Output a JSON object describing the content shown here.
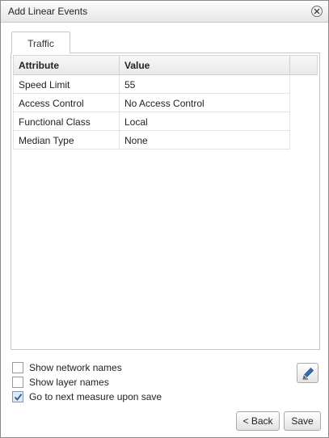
{
  "window": {
    "title": "Add Linear Events"
  },
  "tabs": [
    {
      "label": "Traffic"
    }
  ],
  "table": {
    "columns": [
      "Attribute",
      "Value"
    ],
    "rows": [
      {
        "attribute": "Speed Limit",
        "value": "55"
      },
      {
        "attribute": "Access Control",
        "value": "No Access Control"
      },
      {
        "attribute": "Functional Class",
        "value": "Local"
      },
      {
        "attribute": "Median Type",
        "value": "None"
      }
    ]
  },
  "options": [
    {
      "label": "Show network names",
      "checked": false
    },
    {
      "label": "Show layer names",
      "checked": false
    },
    {
      "label": "Go to next measure upon save",
      "checked": true
    }
  ],
  "icons": {
    "close": "close-icon",
    "edit": "pencil-icon",
    "check": "checkmark-icon"
  },
  "buttons": {
    "back": "< Back",
    "save": "Save"
  }
}
